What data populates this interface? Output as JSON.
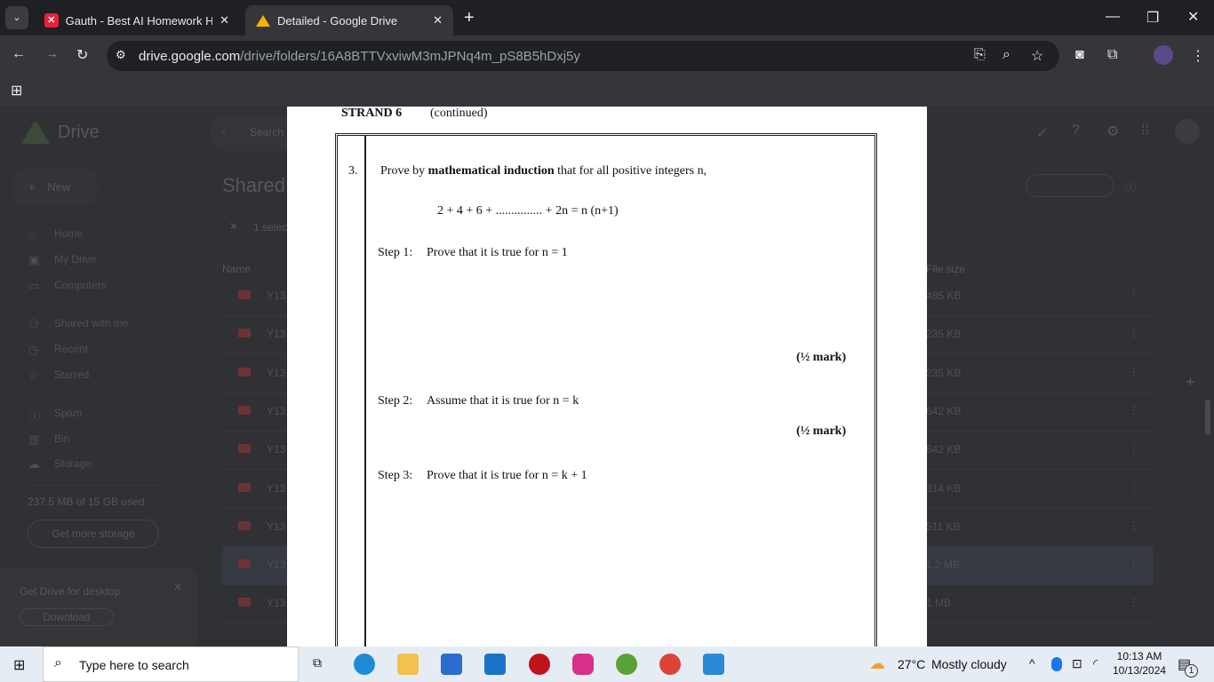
{
  "browser": {
    "tabs": [
      {
        "title": "Gauth - Best AI Homework Help",
        "icon": "gauth-icon",
        "active": false
      },
      {
        "title": "Detailed - Google Drive",
        "icon": "google-drive-icon",
        "active": true
      }
    ],
    "url_domain": "drive.google.com",
    "url_path": "/drive/folders/16A8BTTVxviwM3mJPNq4m_pS8B5hDxj5y"
  },
  "drive": {
    "logo": "Drive",
    "search_placeholder": "Search",
    "new_label": "New",
    "title": "Shared",
    "selection": "1 selec",
    "sidebar": [
      "Home",
      "My Drive",
      "Computers",
      "Shared with me",
      "Recent",
      "Starred",
      "Spam",
      "Bin",
      "Storage"
    ],
    "storage_text": "237.5 MB of 15 GB used",
    "get_storage": "Get more storage",
    "promo": "Get Drive for desktop",
    "download": "Download",
    "columns": {
      "name": "Name",
      "size": "File size"
    },
    "rows": [
      {
        "name": "Y13",
        "size": "485 KB"
      },
      {
        "name": "Y13",
        "size": "235 KB"
      },
      {
        "name": "Y13",
        "size": "235 KB"
      },
      {
        "name": "Y13",
        "size": "642 KB"
      },
      {
        "name": "Y13",
        "size": "642 KB"
      },
      {
        "name": "Y13",
        "size": "314 KB"
      },
      {
        "name": "Y13",
        "size": "511 KB"
      },
      {
        "name": "Y13",
        "size": "1.2 MB",
        "selected": true
      },
      {
        "name": "Y13",
        "size": "1 MB"
      }
    ]
  },
  "doc": {
    "strand": "STRAND 6",
    "continued": "(continued)",
    "qnum": "3.",
    "q_pre": "Prove by ",
    "q_bold": "mathematical induction",
    "q_post": " that for all positive integers n,",
    "equation": "2 + 4 + 6 + ............... + 2n = n (n+1)",
    "step1_label": "Step 1:",
    "step1": "Prove that it is true for n = 1",
    "mark1": "(½ mark)",
    "step2_label": "Step 2:",
    "step2": "Assume that it is true for n = k",
    "mark2": "(½ mark)",
    "step3_label": "Step 3:",
    "step3": "Prove that it is true for n = k + 1"
  },
  "taskbar": {
    "search_placeholder": "Type here to search",
    "weather_temp": "27°C",
    "weather_text": "Mostly cloudy",
    "time": "10:13 AM",
    "date": "10/13/2024",
    "notifications": "1"
  }
}
